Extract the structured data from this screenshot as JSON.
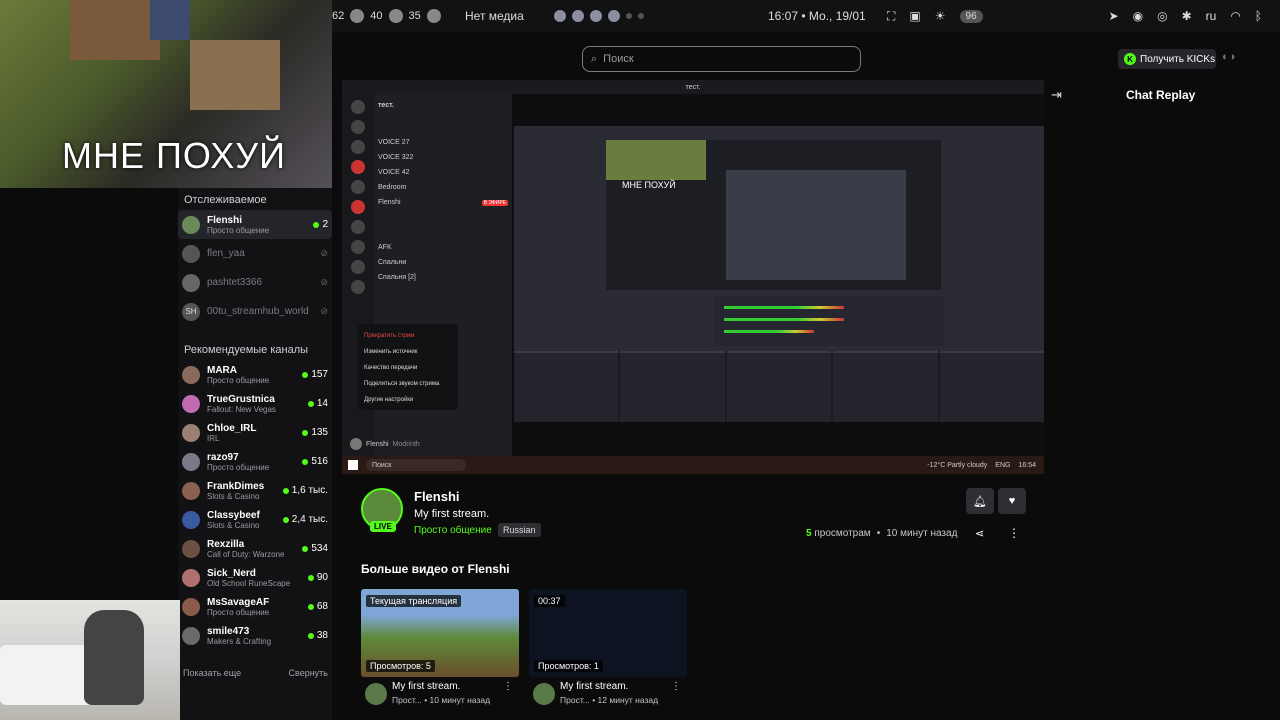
{
  "sysbar": {
    "left_nums": [
      "62",
      "40",
      "35"
    ],
    "media": "Нет медиа",
    "clock": "16:07 • Мо., 19/01",
    "badge": "96",
    "lang": "ru"
  },
  "cam_overlay_text": "МНЕ ПОХУЙ",
  "search": {
    "placeholder": "Поиск"
  },
  "kicks_button": "Получить KICKs",
  "chat_replay": "Chat Replay",
  "sidebar": {
    "followed_title": "Отслеживаемое",
    "followed": [
      {
        "name": "Flenshi",
        "sub": "Просто общение",
        "count": "2",
        "live": true,
        "avatar_color": "#6a8a5a"
      },
      {
        "name": "flen_yaa",
        "sub": "",
        "live": false,
        "avatar_color": "#555"
      },
      {
        "name": "pashtet3366",
        "sub": "",
        "live": false,
        "avatar_color": "#666"
      },
      {
        "name": "00tu_streamhub_world",
        "sub": "",
        "live": false,
        "avatar_color": "#555",
        "initials": "SH"
      }
    ],
    "recommended_title": "Рекомендуемые каналы",
    "recommended": [
      {
        "name": "MARA",
        "sub": "Просто общение",
        "count": "157",
        "avatar_color": "#8a6a5a"
      },
      {
        "name": "TrueGrustnica",
        "sub": "Fallout: New Vegas",
        "count": "14",
        "avatar_color": "#c06ab0"
      },
      {
        "name": "Chloe_IRL",
        "sub": "IRL",
        "count": "135",
        "avatar_color": "#9a8070"
      },
      {
        "name": "razo97",
        "sub": "Просто общение",
        "count": "516",
        "avatar_color": "#7a7a8a"
      },
      {
        "name": "FrankDimes",
        "sub": "Slots & Casino",
        "count": "1,6 тыс.",
        "avatar_color": "#8a6050"
      },
      {
        "name": "Classybeef",
        "sub": "Slots & Casino",
        "count": "2,4 тыс.",
        "avatar_color": "#3a5aa0"
      },
      {
        "name": "Rexzilla",
        "sub": "Call of Duty: Warzone",
        "count": "534",
        "avatar_color": "#6a5040"
      },
      {
        "name": "Sick_Nerd",
        "sub": "Old School RuneScape",
        "count": "90",
        "avatar_color": "#b07070"
      },
      {
        "name": "MsSavageAF",
        "sub": "Просто общение",
        "count": "68",
        "avatar_color": "#8a5a4a"
      },
      {
        "name": "smile473",
        "sub": "Makers & Crafting",
        "count": "38",
        "avatar_color": "#6a6a6a"
      }
    ],
    "show_more": "Показать еще",
    "collapse": "Свернуть"
  },
  "video": {
    "window_title": "тест.",
    "discord": {
      "server": "тест.",
      "channels": [
        "VOICE 27",
        "VOICE 322",
        "VOICE 42",
        "Bedroom",
        "Flenshi",
        "AFK",
        "Спальни",
        "Спальня [2]"
      ],
      "live_label": "В ЭФИРЕ",
      "menu": [
        "Прекратить стрим",
        "Изменить источник",
        "Качество передачи",
        "Поделиться звуком стрима",
        "Другие настройки"
      ],
      "user": "Flenshi",
      "user_status": "Modrinth"
    },
    "obs_overlay": "МНЕ ПОХУЙ",
    "taskbar_search": "Поиск",
    "taskbar_weather": "-12°C Partly cloudy",
    "taskbar_lang": "ENG",
    "taskbar_time": "16:54"
  },
  "stream": {
    "streamer": "Flenshi",
    "live_label": "LIVE",
    "title": "My first stream.",
    "category": "Просто общение",
    "language": "Russian",
    "views_count": "5",
    "views_label": "просмотрам",
    "time_ago": "10 минут назад"
  },
  "more_videos_title": "Больше видео от Flenshi",
  "videos": [
    {
      "tag": "Текущая трансляция",
      "views": "Просмотров: 5",
      "title": "My first stream.",
      "sub": "Прост... • 10 минут назад"
    },
    {
      "tag": "00:37",
      "views": "Просмотров: 1",
      "title": "My first stream.",
      "sub": "Прост... • 12 минут назад"
    }
  ]
}
